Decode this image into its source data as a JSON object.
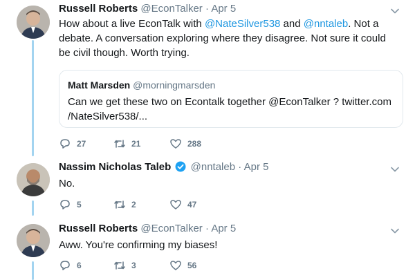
{
  "tweets": [
    {
      "author_name": "Russell Roberts",
      "handle": "@EconTalker",
      "separator": "·",
      "date": "Apr 5",
      "text_parts": [
        "How about a live EconTalk with ",
        "@NateSilver538",
        " and ",
        "@nntaleb",
        ". Not a debate. A conversation exploring where they disagree. Not sure it could be civil though. Worth trying."
      ],
      "quote": {
        "author_name": "Matt Marsden",
        "handle": "@morningmarsden",
        "text_line1": "Can we get these two on Econtalk together @EconTalker ? twitter.com",
        "text_line2": "/NateSilver538/..."
      },
      "replies": "27",
      "retweets": "21",
      "likes": "288"
    },
    {
      "author_name": "Nassim Nicholas Taleb",
      "handle": "@nntaleb",
      "separator": "·",
      "date": "Apr 5",
      "text": "No.",
      "replies": "5",
      "retweets": "2",
      "likes": "47"
    },
    {
      "author_name": "Russell Roberts",
      "handle": "@EconTalker",
      "separator": "·",
      "date": "Apr 5",
      "text": "Aww. You're confirming my biases!",
      "replies": "6",
      "retweets": "3",
      "likes": "56"
    }
  ],
  "icons": {
    "reply": "reply-icon",
    "retweet": "retweet-icon",
    "like": "heart-icon",
    "verified": "verified-badge-icon",
    "caret": "chevron-down-icon"
  },
  "colors": {
    "link": "#1b95e0",
    "thread_line": "#a3d4f0",
    "muted": "#657786",
    "verified": "#1da1f2"
  }
}
